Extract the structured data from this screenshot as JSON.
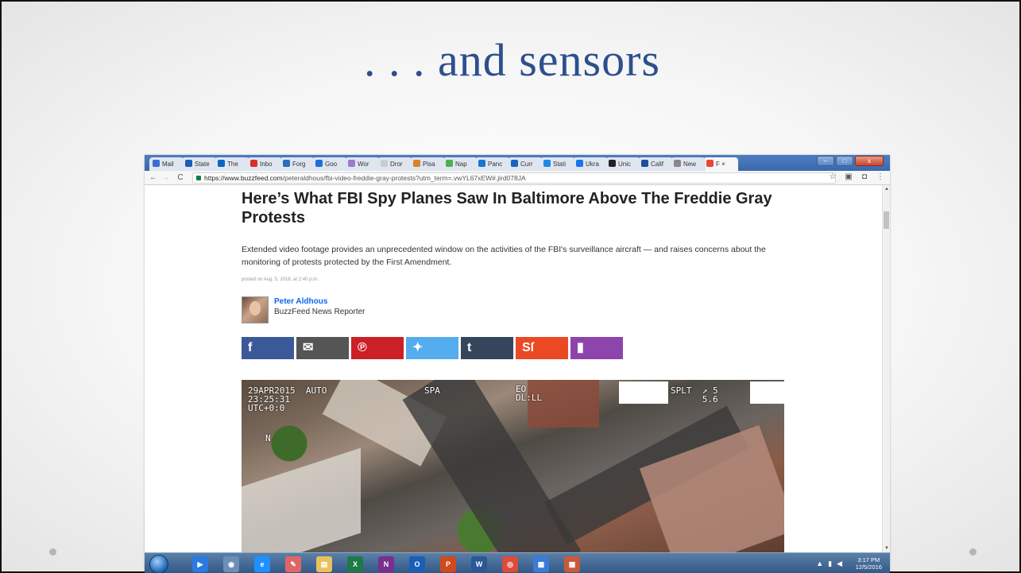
{
  "slide": {
    "title": ". . . and sensors"
  },
  "browser": {
    "tabs": [
      {
        "label": "Mail",
        "color": "#3b6fd4"
      },
      {
        "label": "State",
        "color": "#1a5fb4"
      },
      {
        "label": "The",
        "color": "#0a66c2"
      },
      {
        "label": "Inbo",
        "color": "#d93025"
      },
      {
        "label": "Forg",
        "color": "#2a6ebb"
      },
      {
        "label": "Goo",
        "color": "#1e6fd9"
      },
      {
        "label": "Wor",
        "color": "#9b7bd1"
      },
      {
        "label": "Dror",
        "color": "#cccccc"
      },
      {
        "label": "Pisa",
        "color": "#d9822b"
      },
      {
        "label": "Nap",
        "color": "#4caf50"
      },
      {
        "label": "Panc",
        "color": "#1976d2"
      },
      {
        "label": "Curr",
        "color": "#1565c0"
      },
      {
        "label": "Stati",
        "color": "#1e88e5"
      },
      {
        "label": "Ukra",
        "color": "#1a73e8"
      },
      {
        "label": "Unic",
        "color": "#222222"
      },
      {
        "label": "Calif",
        "color": "#1c4fa0"
      },
      {
        "label": "New",
        "color": "#888888"
      },
      {
        "label": "F ×",
        "color": "#e8453c"
      }
    ],
    "window_buttons": [
      "–",
      "□",
      "x"
    ],
    "nav": {
      "back": "←",
      "forward": "→",
      "reload": "C"
    },
    "url_host": "https://www.buzzfeed.com",
    "url_path": "/peteraldhous/fbi-video-freddie-gray-protests?utm_term=.vwYL67xEW#.jird078JA",
    "toolbar_icons": [
      "star-icon",
      "extension-icon",
      "cast-icon",
      "menu-icon"
    ],
    "toolbar_glyphs": [
      "☆",
      "▣",
      "◘",
      "⋮"
    ]
  },
  "article": {
    "headline": "Here’s What FBI Spy Planes Saw In Baltimore Above The Freddie Gray Protests",
    "dek": "Extended video footage provides an unprecedented window on the activities of the FBI's surveillance aircraft — and raises concerns about the monitoring of protests protected by the First Amendment.",
    "posted": "posted on Aug. 5, 2016, at 2:40 p.m.",
    "author_name": "Peter Aldhous",
    "author_role": "BuzzFeed News Reporter",
    "share_buttons": [
      {
        "name": "facebook",
        "glyph": "f",
        "color": "#3b5998"
      },
      {
        "name": "email",
        "glyph": "✉",
        "color": "#555555"
      },
      {
        "name": "pinterest",
        "glyph": "℗",
        "color": "#cb2027"
      },
      {
        "name": "twitter",
        "glyph": "✦",
        "color": "#55acee"
      },
      {
        "name": "tumblr",
        "glyph": "t",
        "color": "#35465c"
      },
      {
        "name": "stumbleupon",
        "glyph": "Sſ",
        "color": "#eb4924"
      },
      {
        "name": "bookmark",
        "glyph": "▮",
        "color": "#8e44ad"
      }
    ],
    "hud": {
      "timestamp": "29APR2015  AUTO\n23:25:31\nUTC+0:0",
      "spa": "SPA",
      "eo": "EO\nDL:LL",
      "right": "SPLT  ↗ 5\n      5.6",
      "north": "N"
    }
  },
  "taskbar": {
    "apps": [
      {
        "name": "media-player",
        "label": "▶",
        "color": "#2a7ae2"
      },
      {
        "name": "camera",
        "label": "◉",
        "color": "#6b8fb8"
      },
      {
        "name": "internet-explorer",
        "label": "e",
        "color": "#1e90ff"
      },
      {
        "name": "paint",
        "label": "✎",
        "color": "#e06666"
      },
      {
        "name": "file-explorer",
        "label": "▤",
        "color": "#e8c15b"
      },
      {
        "name": "excel",
        "label": "X",
        "color": "#1d7a45"
      },
      {
        "name": "onenote",
        "label": "N",
        "color": "#7a2e8e"
      },
      {
        "name": "outlook",
        "label": "O",
        "color": "#1a5fb4"
      },
      {
        "name": "powerpoint",
        "label": "P",
        "color": "#d04a1d"
      },
      {
        "name": "word",
        "label": "W",
        "color": "#2b5797"
      },
      {
        "name": "chrome",
        "label": "◎",
        "color": "#dd4b39"
      },
      {
        "name": "remote-desktop",
        "label": "▦",
        "color": "#3a7bd5"
      },
      {
        "name": "app-window",
        "label": "▩",
        "color": "#c85a3a"
      }
    ],
    "time": "3:17 PM",
    "date": "12/5/2016"
  }
}
